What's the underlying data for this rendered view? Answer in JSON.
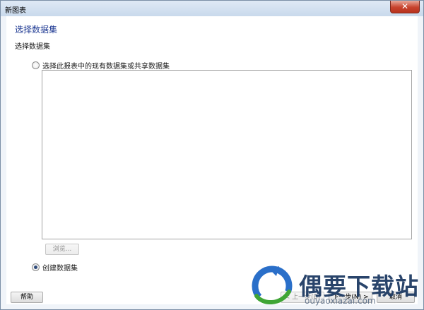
{
  "window": {
    "title": "新图表",
    "close_glyph": "✕"
  },
  "page": {
    "title": "选择数据集",
    "section_label": "选择数据集"
  },
  "options": {
    "existing_dataset": {
      "label": "选择此报表中的现有数据集或共享数据集",
      "checked": false
    },
    "create_dataset": {
      "label": "创建数据集",
      "checked": true
    }
  },
  "buttons": {
    "browse": "浏览...",
    "help": "帮助",
    "back": "< 上一步(B)",
    "next": "下一步(N) >",
    "cancel": "取消"
  },
  "watermark": {
    "brand": "偶要下载站",
    "url": "ouyaoxiazai.com",
    "colors": {
      "blue": "#2a6fc9",
      "green": "#3fa535",
      "text": "#17355f"
    }
  },
  "icons": {
    "close": "close-icon",
    "logo": "watermark-logo-icon"
  }
}
